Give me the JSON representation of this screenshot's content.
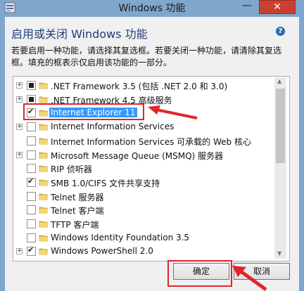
{
  "window": {
    "title": "Windows 功能",
    "minimize_glyph": "—",
    "close_glyph": "✕"
  },
  "header": {
    "title": "启用或关闭 Windows 功能",
    "help_glyph": "?"
  },
  "description": "若要启用一种功能，请选择其复选框。若要关闭一种功能，请清除其复选框。填充的框表示仅启用该功能的一部分。",
  "features": [
    {
      "label": ".NET Framework 3.5 (包括 .NET 2.0 和 3.0)",
      "expandable": true,
      "state": "partial",
      "selected": false
    },
    {
      "label": ".NET Framework 4.5 高级服务",
      "expandable": true,
      "state": "partial",
      "selected": false
    },
    {
      "label": "Internet Explorer 11",
      "expandable": false,
      "state": "checked",
      "selected": true
    },
    {
      "label": "Internet Information Services",
      "expandable": true,
      "state": "unchecked",
      "selected": false
    },
    {
      "label": "Internet Information Services 可承载的 Web 核心",
      "expandable": false,
      "state": "unchecked",
      "selected": false
    },
    {
      "label": "Microsoft Message Queue (MSMQ) 服务器",
      "expandable": true,
      "state": "unchecked",
      "selected": false
    },
    {
      "label": "RIP 侦听器",
      "expandable": false,
      "state": "unchecked",
      "selected": false
    },
    {
      "label": "SMB 1.0/CIFS 文件共享支持",
      "expandable": false,
      "state": "checked",
      "selected": false
    },
    {
      "label": "Telnet 服务器",
      "expandable": false,
      "state": "unchecked",
      "selected": false
    },
    {
      "label": "Telnet 客户端",
      "expandable": false,
      "state": "unchecked",
      "selected": false
    },
    {
      "label": "TFTP 客户端",
      "expandable": false,
      "state": "unchecked",
      "selected": false
    },
    {
      "label": "Windows Identity Foundation 3.5",
      "expandable": false,
      "state": "unchecked",
      "selected": false
    },
    {
      "label": "Windows PowerShell 2.0",
      "expandable": true,
      "state": "checked",
      "selected": false
    }
  ],
  "buttons": {
    "ok": "确定",
    "cancel": "取消"
  },
  "colors": {
    "frame": "#7fa6cd",
    "close": "#c94031",
    "selection": "#3399ff",
    "annotation": "#e0252b"
  }
}
